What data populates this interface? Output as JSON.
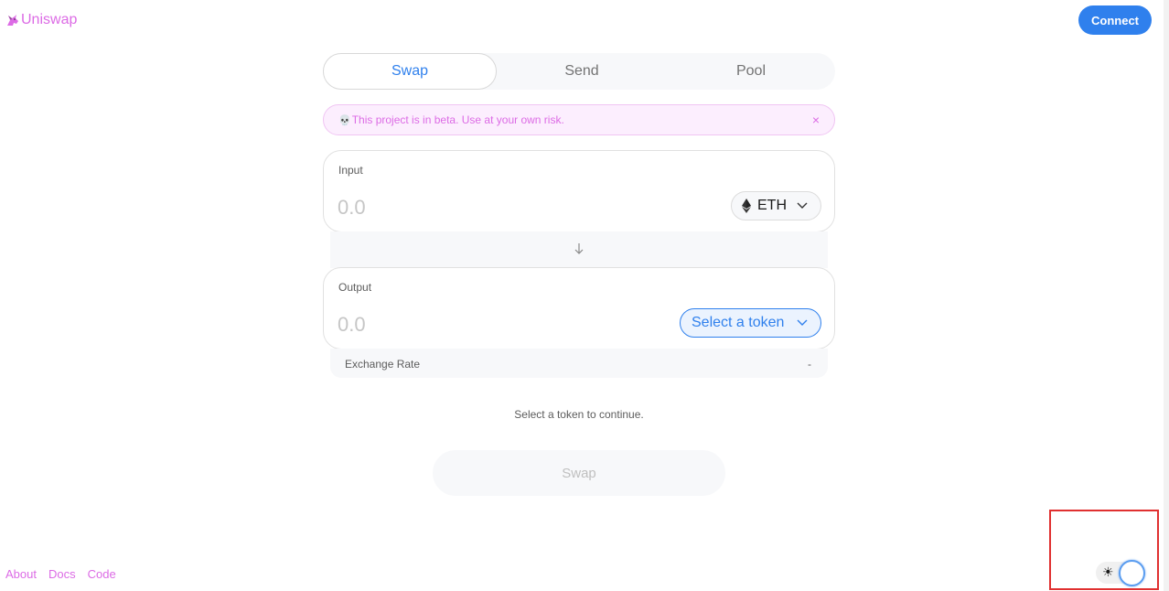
{
  "app": {
    "title": "Uniswap",
    "brand_color": "#DC6BE5",
    "accent_color": "#2F80ED",
    "logo_icon": "unicorn-icon"
  },
  "header": {
    "connect_label": "Connect"
  },
  "tabs": [
    {
      "label": "Swap",
      "active": true
    },
    {
      "label": "Send",
      "active": false
    },
    {
      "label": "Pool",
      "active": false
    }
  ],
  "beta_banner": {
    "icon": "skull-icon",
    "text": "This project is in beta. Use at your own risk.",
    "close": "×"
  },
  "input_panel": {
    "label": "Input",
    "placeholder": "0.0",
    "token": "ETH",
    "token_icon": "ethereum-icon"
  },
  "output_panel": {
    "label": "Output",
    "placeholder": "0.0",
    "token": "Select a token"
  },
  "exchange_rate": {
    "label": "Exchange Rate",
    "value": "-"
  },
  "hint": "Select a token to continue.",
  "swap_button": "Swap",
  "footer": {
    "links": [
      "About",
      "Docs",
      "Code"
    ]
  },
  "theme_toggle": {
    "icon": "sun-icon",
    "glyph": "☀",
    "state": "light"
  }
}
